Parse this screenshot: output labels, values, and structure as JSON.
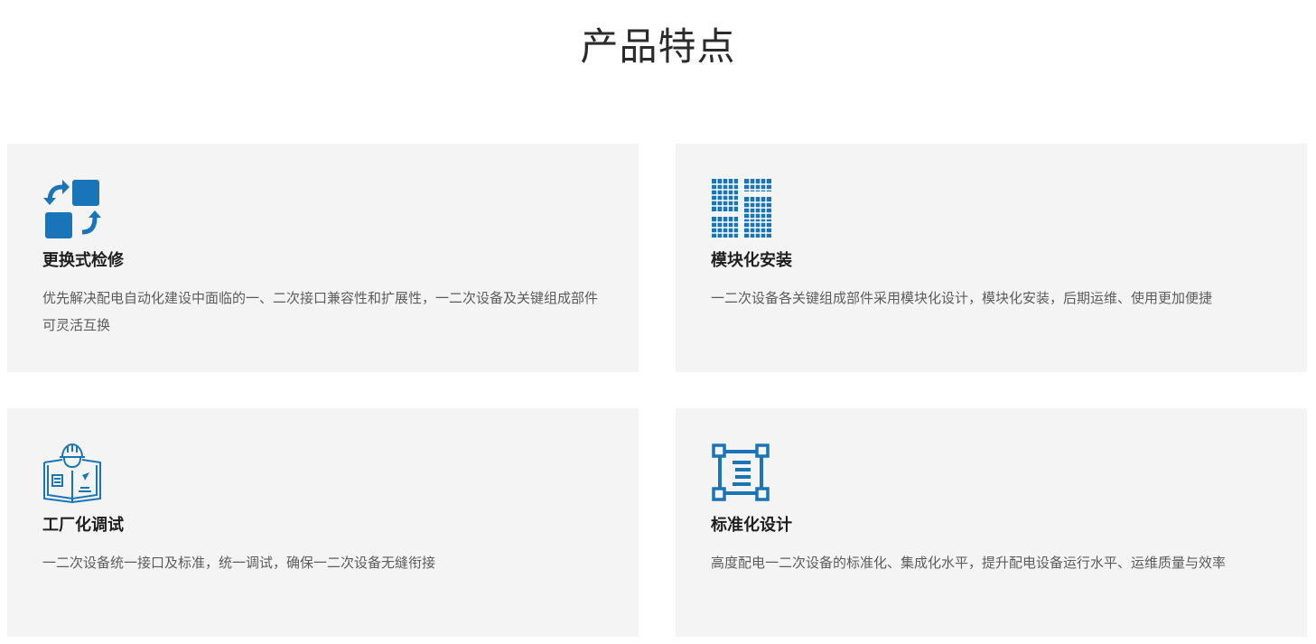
{
  "page": {
    "title": "产品特点"
  },
  "colors": {
    "accent": "#1a75b8",
    "card_bg": "#f4f4f4"
  },
  "features": [
    {
      "icon": "swap-icon",
      "title": "更换式检修",
      "desc": "优先解决配电自动化建设中面临的一、二次接口兼容性和扩展性，一二次设备及关键组成部件可灵活互换"
    },
    {
      "icon": "module-grid-icon",
      "title": "模块化安装",
      "desc": "一二次设备各关键组成部件采用模块化设计，模块化安装，后期运维、使用更加便捷"
    },
    {
      "icon": "engineer-manual-icon",
      "title": "工厂化调试",
      "desc": "一二次设备统一接口及标准，统一调试，确保一二次设备无缝衔接"
    },
    {
      "icon": "standard-frame-icon",
      "title": "标准化设计",
      "desc": "高度配电一二次设备的标准化、集成化水平，提升配电设备运行水平、运维质量与效率"
    }
  ]
}
